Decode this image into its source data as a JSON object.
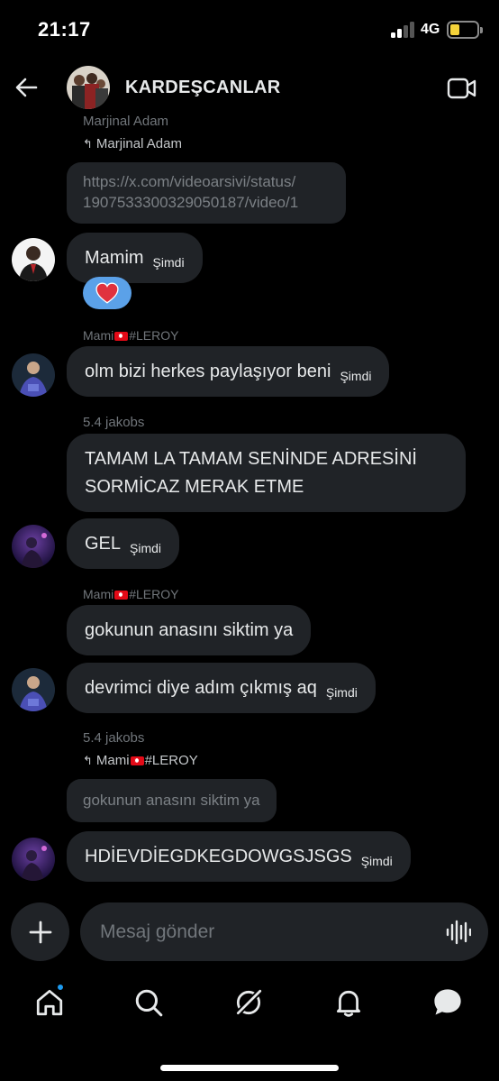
{
  "status_bar": {
    "time": "21:17",
    "network": "4G"
  },
  "header": {
    "title": "KARDEŞCANLAR"
  },
  "messages": {
    "m0_author": "Marjinal Adam",
    "m0_reply_to": "Marjinal Adam",
    "m0_link": "https://x.com/videoarsivi/status/\n1907533300329050187/video/1",
    "m1_text": "Mamim",
    "m1_time": "Şimdi",
    "m1_reaction": "❤️",
    "m2_author": "Mami",
    "m2_author_suffix": "#LEROY",
    "m2_text": "olm bizi herkes paylaşıyor beni",
    "m2_time": "Şimdi",
    "m3_author": "5.4 jakobs",
    "m3_text": "TAMAM LA TAMAM SENİNDE ADRESİNİ\nSORMİCAZ MERAK ETME",
    "m4_text": "GEL",
    "m4_time": "Şimdi",
    "m5_author": "Mami",
    "m5_author_suffix": "#LEROY",
    "m5_text": "gokunun anasını siktim ya",
    "m6_text": "devrimci diye adım çıkmış aq",
    "m6_time": "Şimdi",
    "m7_author": "5.4 jakobs",
    "m7_reply_to": "Mami",
    "m7_reply_to_suffix": "#LEROY",
    "m7_quote": "gokunun anasını siktim ya",
    "m8_text": "HDİEVDİEGDKEGDOWGSJSGS",
    "m8_time": "Şimdi"
  },
  "composer": {
    "placeholder": "Mesaj gönder"
  },
  "nav": {
    "icons": [
      "home-icon",
      "search-icon",
      "grok-icon",
      "bell-icon",
      "messages-icon"
    ],
    "home_has_badge": true
  },
  "colors": {
    "background": "#000000",
    "bubble": "#202327",
    "muted": "#71767b",
    "accent": "#1d9bf0",
    "reaction": "#5ba1e8"
  }
}
